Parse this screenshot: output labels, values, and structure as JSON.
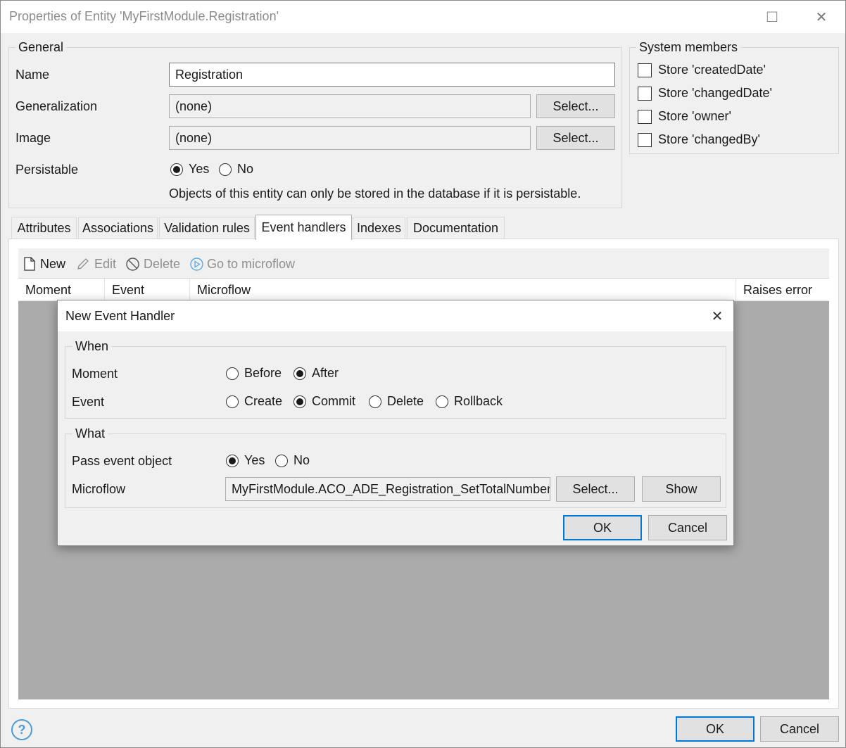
{
  "window": {
    "title": "Properties of Entity 'MyFirstModule.Registration'",
    "maximize_icon": "□",
    "close_icon": "✕"
  },
  "general": {
    "group_title": "General",
    "name_label": "Name",
    "name_value": "Registration",
    "generalization_label": "Generalization",
    "generalization_value": "(none)",
    "generalization_button": "Select...",
    "image_label": "Image",
    "image_value": "(none)",
    "image_button": "Select...",
    "persistable_label": "Persistable",
    "persistable_yes": "Yes",
    "persistable_no": "No",
    "persistable_selected": "Yes",
    "persistable_note": "Objects of this entity can only be stored in the database if it is persistable."
  },
  "system_members": {
    "group_title": "System members",
    "items": [
      {
        "label": "Store 'createdDate'",
        "checked": false
      },
      {
        "label": "Store 'changedDate'",
        "checked": false
      },
      {
        "label": "Store 'owner'",
        "checked": false
      },
      {
        "label": "Store 'changedBy'",
        "checked": false
      }
    ]
  },
  "tabs": [
    {
      "label": "Attributes",
      "active": false
    },
    {
      "label": "Associations",
      "active": false
    },
    {
      "label": "Validation rules",
      "active": false
    },
    {
      "label": "Event handlers",
      "active": true
    },
    {
      "label": "Indexes",
      "active": false
    },
    {
      "label": "Documentation",
      "active": false
    }
  ],
  "toolbar": {
    "new_label": "New",
    "edit_label": "Edit",
    "delete_label": "Delete",
    "goto_label": "Go to microflow"
  },
  "grid": {
    "columns": [
      "Moment",
      "Event",
      "Microflow",
      "Raises error"
    ]
  },
  "modal": {
    "title": "New Event Handler",
    "close_icon": "✕",
    "when_title": "When",
    "moment_label": "Moment",
    "moment_options": [
      "Before",
      "After"
    ],
    "moment_selected": "After",
    "event_label": "Event",
    "event_options": [
      "Create",
      "Commit",
      "Delete",
      "Rollback"
    ],
    "event_selected": "Commit",
    "what_title": "What",
    "pass_label": "Pass event object",
    "pass_options": [
      "Yes",
      "No"
    ],
    "pass_selected": "Yes",
    "microflow_label": "Microflow",
    "microflow_value": "MyFirstModule.ACO_ADE_Registration_SetTotalNumberOf",
    "select_button": "Select...",
    "show_button": "Show",
    "ok_button": "OK",
    "cancel_button": "Cancel"
  },
  "footer": {
    "help_icon": "?",
    "ok_button": "OK",
    "cancel_button": "Cancel"
  }
}
